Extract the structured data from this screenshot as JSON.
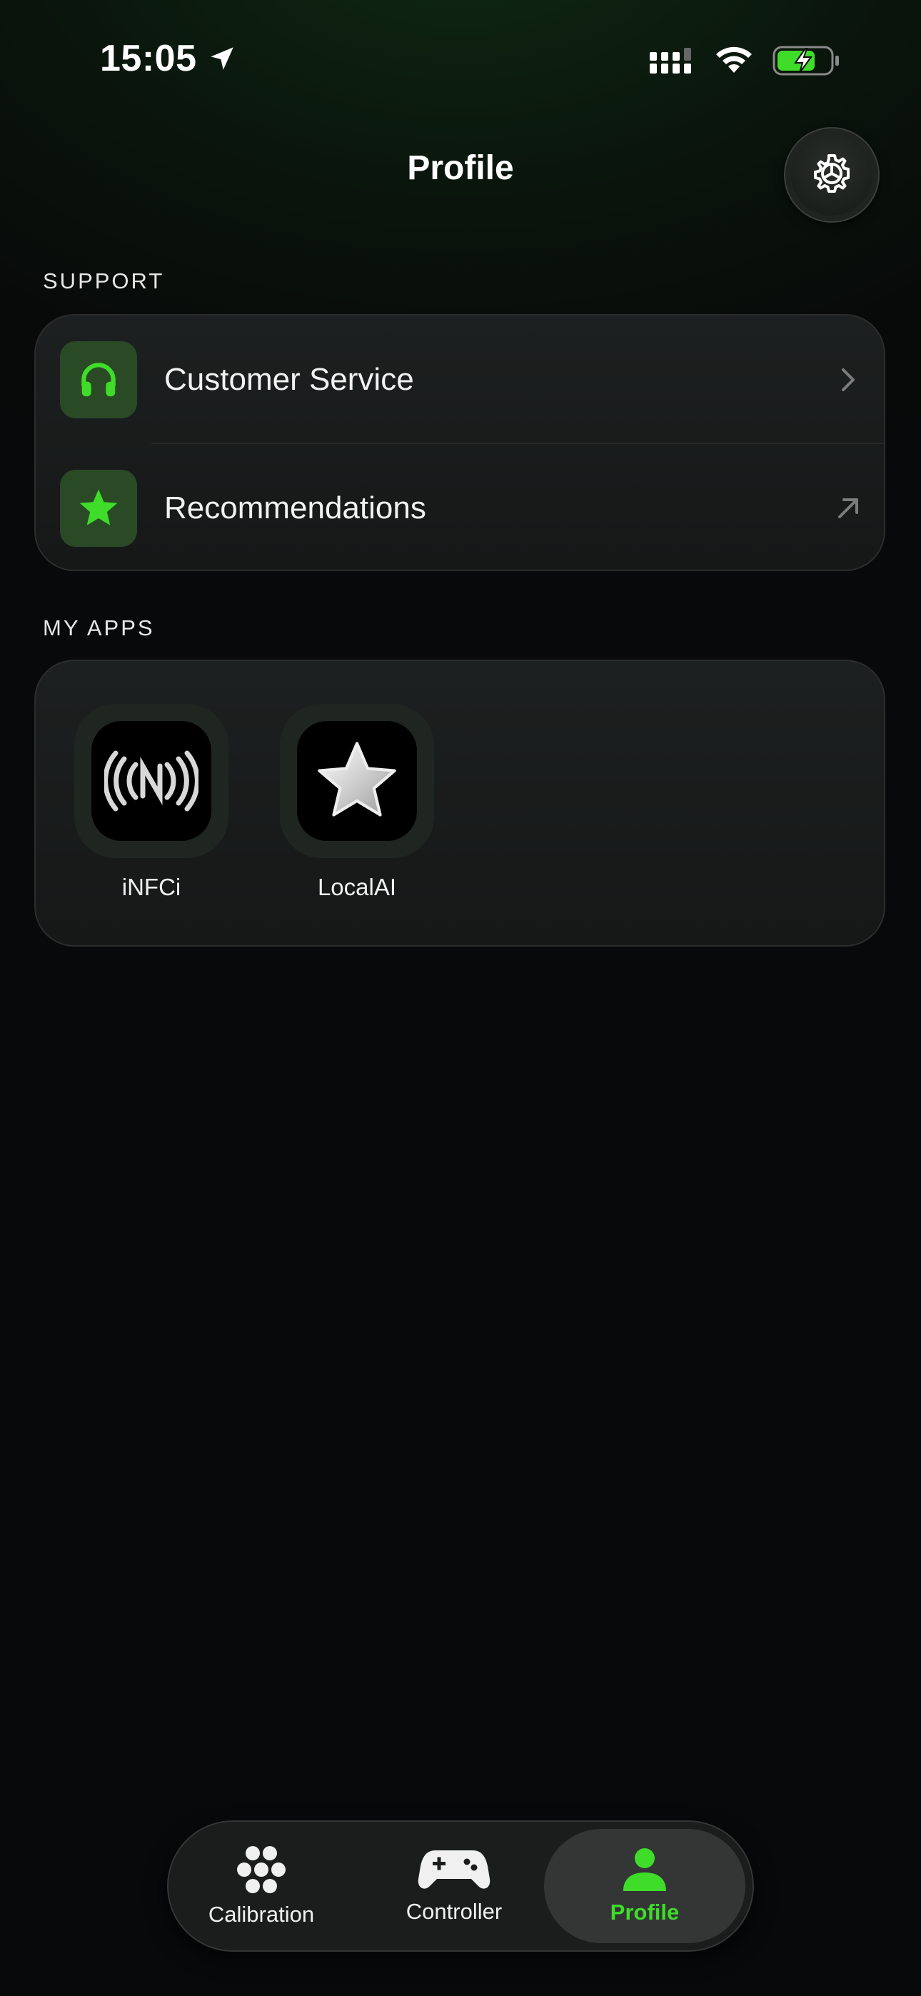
{
  "status_bar": {
    "time": "15:05"
  },
  "header": {
    "title": "Profile"
  },
  "support": {
    "section_label": "SUPPORT",
    "items": [
      {
        "label": "Customer Service",
        "icon": "headphones-icon",
        "accessory": "chevron-right-icon"
      },
      {
        "label": "Recommendations",
        "icon": "star-icon",
        "accessory": "arrow-up-right-icon"
      }
    ]
  },
  "my_apps": {
    "section_label": "MY APPS",
    "apps": [
      {
        "name": "iNFCi",
        "icon": "nfc-icon"
      },
      {
        "name": "LocalAI",
        "icon": "silver-star-icon"
      }
    ]
  },
  "tabbar": {
    "tabs": [
      {
        "label": "Calibration",
        "icon": "calibration-dots-icon"
      },
      {
        "label": "Controller",
        "icon": "gamepad-icon"
      },
      {
        "label": "Profile",
        "icon": "person-icon",
        "active": true
      }
    ]
  },
  "colors": {
    "accent": "#3fdc2a",
    "icon_bg": "#2a4a26",
    "card_bg": "#1b1d1d"
  }
}
